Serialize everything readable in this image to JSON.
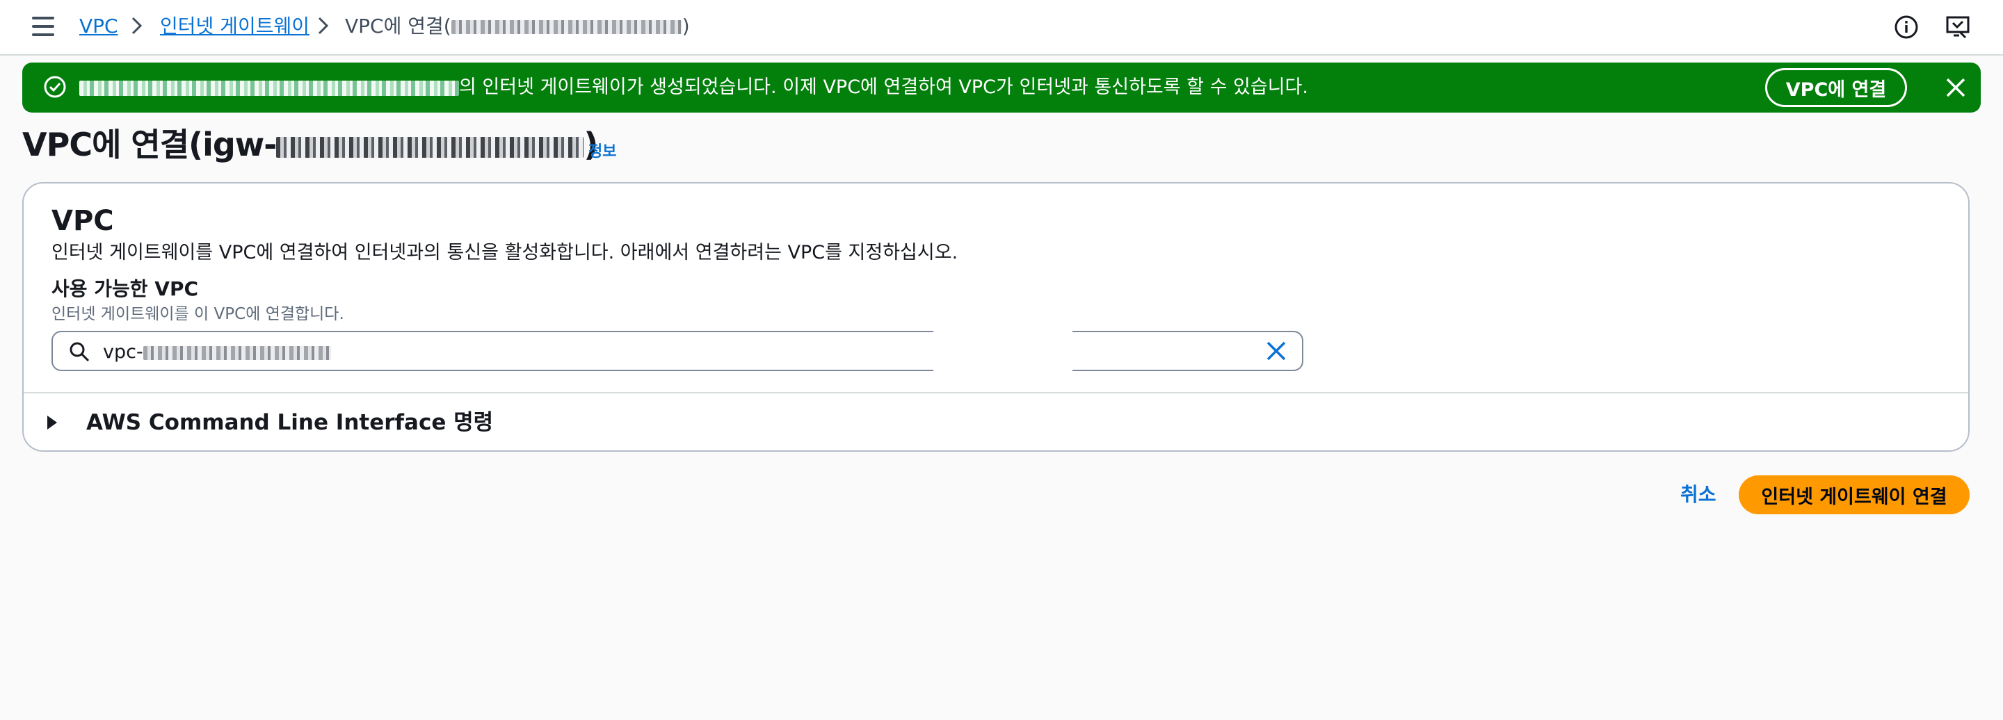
{
  "breadcrumb": {
    "items": [
      {
        "label": "VPC"
      },
      {
        "label": "인터넷 게이트웨이"
      }
    ],
    "current_prefix": "VPC에 연결(",
    "current_suffix": ")"
  },
  "banner": {
    "message_suffix": "의 인터넷 게이트웨이가 생성되었습니다. 이제 VPC에 연결하여 VPC가 인터넷과 통신하도록 할 수 있습니다.",
    "action_label": "VPC에 연결",
    "color": "#037f0c"
  },
  "page": {
    "title_prefix": "VPC에 연결(igw-",
    "title_suffix": ")",
    "info_label": "정보"
  },
  "vpc_section": {
    "title": "VPC",
    "description": "인터넷 게이트웨이를 VPC에 연결하여 인터넷과의 통신을 활성화합니다. 아래에서 연결하려는 VPC를 지정하십시오.",
    "field_label": "사용 가능한 VPC",
    "field_description": "인터넷 게이트웨이를 이 VPC에 연결합니다.",
    "search_value_prefix": "vpc-"
  },
  "cli_section": {
    "label": "AWS Command Line Interface 명령"
  },
  "actions": {
    "cancel_label": "취소",
    "primary_label": "인터넷 게이트웨이 연결",
    "primary_color": "#ff9900"
  },
  "icons": {
    "menu": "hamburger-menu-icon",
    "info": "info-circle-icon",
    "feedback": "feedback-screen-icon",
    "success": "check-circle-icon",
    "close": "close-icon",
    "search": "search-icon",
    "clear": "clear-icon",
    "caret": "caret-right-icon"
  }
}
